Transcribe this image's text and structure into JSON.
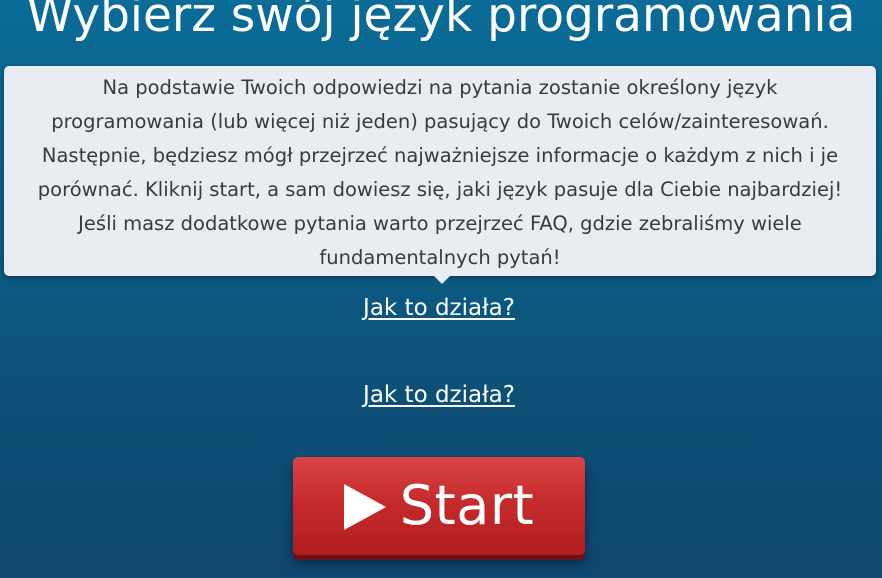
{
  "header": {
    "title": "Wybierz swój język programowania"
  },
  "tooltip": {
    "lines": [
      "Na podstawie Twoich odpowiedzi na pytania zostanie określony język",
      "programowania (lub więcej niż jeden) pasujący do Twoich celów/zainteresowań.",
      "Następnie, będziesz mógł przejrzeć najważniejsze informacje o każdym z nich i je",
      "porównać. Kliknij start, a sam dowiesz się, jaki język pasuje dla Ciebie najbardziej!",
      "Jeśli masz dodatkowe pytania warto przejrzeć FAQ, gdzie zebraliśmy wiele",
      "fundamentalnych pytań!"
    ]
  },
  "links": {
    "how_it_works_1": "Jak to działa?",
    "how_it_works_2": "Jak to działa?"
  },
  "start_button": {
    "label": "Start",
    "icon": "play-icon"
  },
  "colors": {
    "background_top": "#0a6c97",
    "background_bottom": "#0e4770",
    "tooltip_bg": "#e9ecf1",
    "button_red": "#c62b2c"
  }
}
